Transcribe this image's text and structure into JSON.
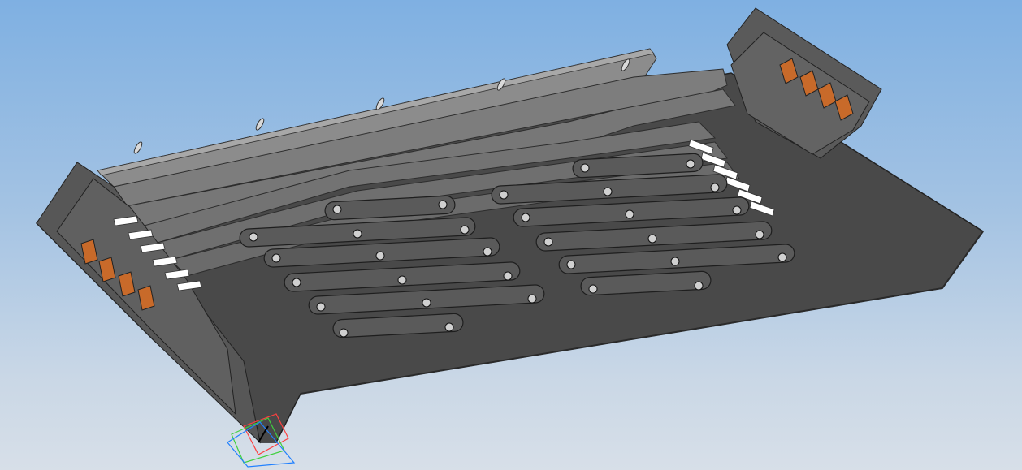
{
  "viewport": {
    "background_top": "#7fb0e2",
    "background_bottom": "#d7dfe8"
  },
  "model": {
    "part": "telescopic-way-cover",
    "plate_color": "#4a4a4a",
    "plate_edge_color": "#2a2a2a",
    "flange_color": "#7a7a7a",
    "wiper_color": "#ffffff",
    "bumper_color": "#d2691e",
    "link_color": "#555555",
    "link_edge_color": "#1e1e1e",
    "icons": [
      "triad-icon"
    ]
  },
  "triad": {
    "x_color": "#ff4040",
    "y_color": "#40d040",
    "z_color": "#2080ff"
  }
}
